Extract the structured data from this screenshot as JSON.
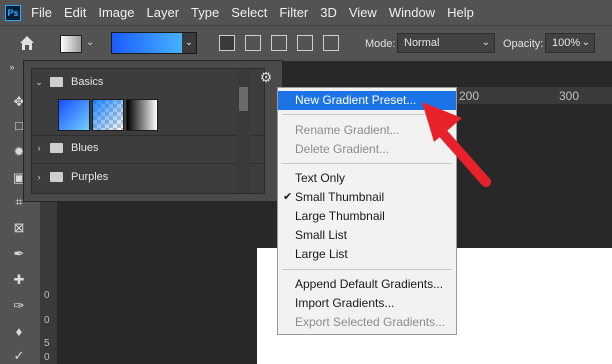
{
  "app": {
    "logo": "Ps"
  },
  "menu": [
    "File",
    "Edit",
    "Image",
    "Layer",
    "Type",
    "Select",
    "Filter",
    "3D",
    "View",
    "Window",
    "Help"
  ],
  "options": {
    "mode_label": "Mode:",
    "mode_value": "Normal",
    "opacity_label": "Opacity:",
    "opacity_value": "100%"
  },
  "ruler_h": [
    "200",
    "300"
  ],
  "ruler_v": [
    "0",
    "0",
    "5",
    "0"
  ],
  "panel": {
    "folders": [
      "Basics",
      "Blues",
      "Purples"
    ]
  },
  "context_menu": {
    "group1": [
      "New Gradient Preset..."
    ],
    "group2": [
      "Rename Gradient...",
      "Delete Gradient..."
    ],
    "group3": [
      "Text Only",
      "Small Thumbnail",
      "Large Thumbnail",
      "Small List",
      "Large List"
    ],
    "group4": [
      "Append Default Gradients...",
      "Import Gradients...",
      "Export Selected Gradients..."
    ],
    "checked": "Small Thumbnail",
    "highlighted": "New Gradient Preset..."
  },
  "colors": {
    "highlight": "#1c73e8",
    "annotation_arrow": "#e8222a"
  }
}
